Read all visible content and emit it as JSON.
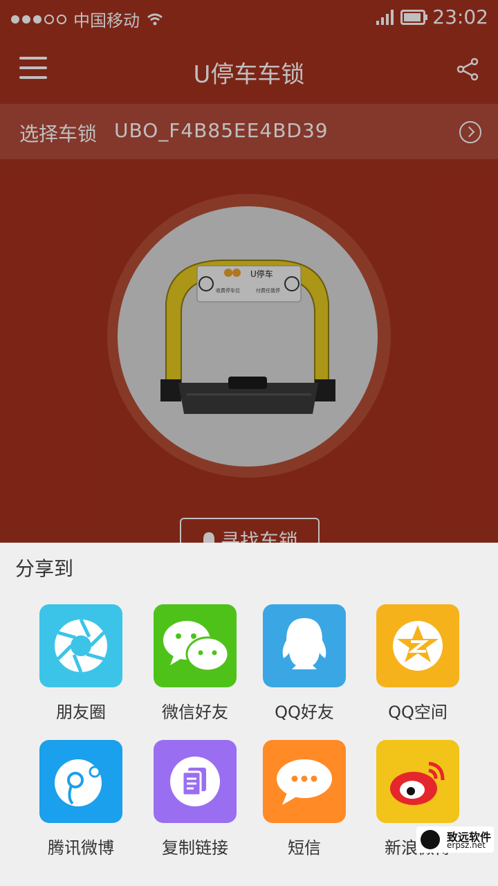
{
  "statusbar": {
    "carrier": "中国移动",
    "time": "23:02"
  },
  "toolbar": {
    "title": "U停车车锁"
  },
  "selector": {
    "label": "选择车锁",
    "value": "UBO_F4B85EE4BD39"
  },
  "actions": {
    "find_label": "寻找车锁"
  },
  "product_image": {
    "brand": "U停车",
    "sticker_left": "收费停车位",
    "sticker_right": "付费任我停"
  },
  "share_sheet": {
    "title": "分享到",
    "items": [
      {
        "label": "朋友圈",
        "icon": "moments-icon",
        "color": "#3cc4e8"
      },
      {
        "label": "微信好友",
        "icon": "wechat-icon",
        "color": "#4fc21a"
      },
      {
        "label": "QQ好友",
        "icon": "qq-icon",
        "color": "#3aa7e4"
      },
      {
        "label": "QQ空间",
        "icon": "qzone-icon",
        "color": "#f6b21b"
      },
      {
        "label": "腾讯微博",
        "icon": "tencent-weibo-icon",
        "color": "#1aa0ec"
      },
      {
        "label": "复制链接",
        "icon": "copy-link-icon",
        "color": "#9a6ef0"
      },
      {
        "label": "短信",
        "icon": "sms-icon",
        "color": "#ff8a26"
      },
      {
        "label": "新浪微博",
        "icon": "sina-weibo-icon",
        "color": "#f2c319"
      }
    ]
  },
  "watermark": {
    "name": "致远软件",
    "site": "erpsz.net"
  }
}
